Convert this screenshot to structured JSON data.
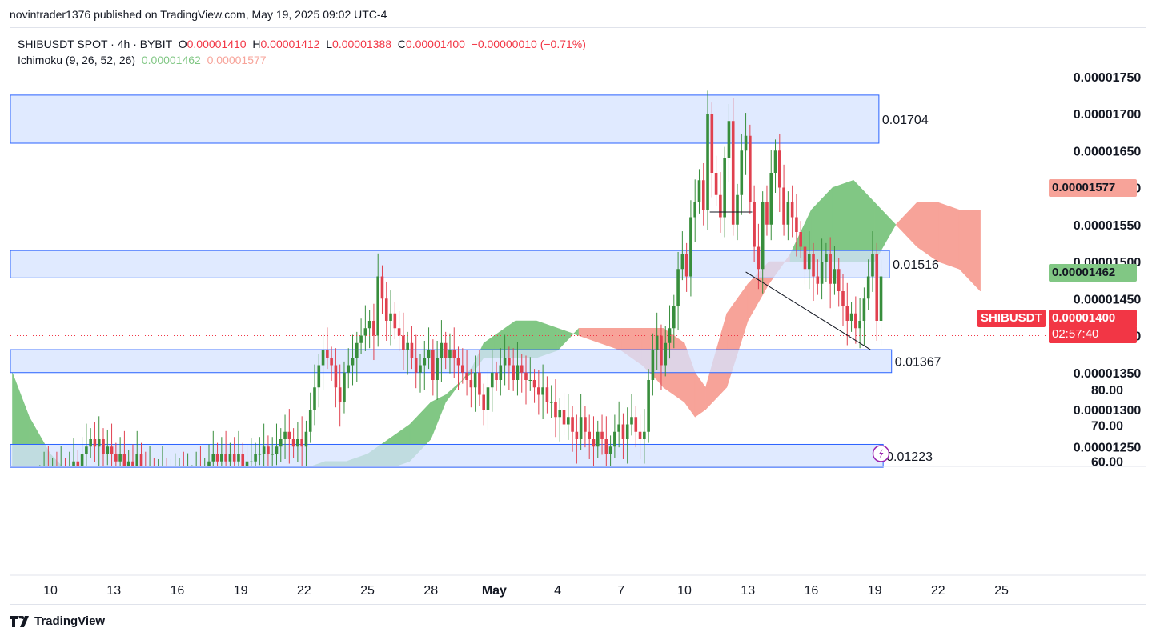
{
  "publish_line": "novintrader1376 published on TradingView.com, May 19, 2025 09:02 UTC-4",
  "legend": {
    "symbol_line": "SHIBUSDT SPOT · 4h · BYBIT",
    "o_label": "O",
    "o_value": "0.00001410",
    "h_label": "H",
    "h_value": "0.00001412",
    "l_label": "L",
    "l_value": "0.00001388",
    "c_label": "C",
    "c_value": "0.00001400",
    "change": "−0.00000010 (−0.71%)",
    "indicator": "Ichimoku (9, 26, 52, 26)",
    "ind_value_1": "0.00001462",
    "ind_value_2": "0.00001577"
  },
  "tags": {
    "senkou_b": "0.00001577",
    "senkou_a": "0.00001462",
    "symbol": "SHIBUSDT",
    "last_price": "0.00001400",
    "countdown": "02:57:40"
  },
  "brand": "TradingView",
  "colors": {
    "up": "#26a69a",
    "candle_up": "#388e3c",
    "candle_down": "#e0414f",
    "cloud_bull": "#81c784",
    "cloud_bear": "#f7a399",
    "zone_fill": "#d6e3ff",
    "zone_border": "#2962ff",
    "price_line": "#f23645"
  },
  "chart_data": {
    "type": "candlestick",
    "ylim": [
      1.22e-05,
      1.78e-05
    ],
    "price_axis_ticks": [
      "0.00001750",
      "0.00001700",
      "0.00001650",
      "0.00001600",
      "0.00001550",
      "0.00001500",
      "0.00001450",
      "0.00001400",
      "0.00001350",
      "0.00001300",
      "0.00001250"
    ],
    "price_axis_tick_values": [
      1.75e-05,
      1.7e-05,
      1.65e-05,
      1.6e-05,
      1.55e-05,
      1.5e-05,
      1.45e-05,
      1.4e-05,
      1.35e-05,
      1.3e-05,
      1.25e-05
    ],
    "lower_axis_ticks": [
      "80.00",
      "70.00",
      "60.00"
    ],
    "lower_axis_tick_values": [
      80,
      70,
      60
    ],
    "lower_axis_range": [
      50,
      84
    ],
    "x_axis_ticks": [
      {
        "label": "10",
        "day": 0
      },
      {
        "label": "13",
        "day": 3
      },
      {
        "label": "16",
        "day": 6
      },
      {
        "label": "19",
        "day": 9
      },
      {
        "label": "22",
        "day": 12
      },
      {
        "label": "25",
        "day": 15
      },
      {
        "label": "28",
        "day": 18
      },
      {
        "label": "May",
        "day": 21,
        "bold": true
      },
      {
        "label": "4",
        "day": 24
      },
      {
        "label": "7",
        "day": 27
      },
      {
        "label": "10",
        "day": 30
      },
      {
        "label": "13",
        "day": 33
      },
      {
        "label": "16",
        "day": 36
      },
      {
        "label": "19",
        "day": 39
      },
      {
        "label": "22",
        "day": 42
      },
      {
        "label": "25",
        "day": 45
      }
    ],
    "zones": [
      {
        "label": "0.01704",
        "top": 1.725e-05,
        "bottom": 1.66e-05,
        "end_day": 39.2
      },
      {
        "label": "0.01516",
        "top": 1.515e-05,
        "bottom": 1.478e-05,
        "end_day": 39.7
      },
      {
        "label": "0.01367",
        "top": 1.381e-05,
        "bottom": 1.35e-05,
        "end_day": 39.8
      },
      {
        "label": "0.01223",
        "top": 1.253e-05,
        "bottom": 1.222e-05,
        "end_day": 39.4
      }
    ],
    "trendlines": [
      {
        "from": [
          32.9,
          1.486e-05
        ],
        "to": [
          38.8,
          1.381e-05
        ]
      },
      {
        "from": [
          31.2,
          1.567e-05
        ],
        "to": [
          33.2,
          1.567e-05
        ]
      }
    ],
    "last_price": 1.4e-05,
    "cloud": {
      "days": [
        -1.8,
        -1,
        0,
        1,
        2,
        3,
        4,
        5,
        6,
        7,
        8,
        9,
        10,
        11,
        11.5,
        12,
        13,
        14,
        15,
        16,
        17,
        18,
        18.7,
        19.5,
        20,
        20.5,
        21,
        22,
        23,
        24,
        25,
        26,
        27,
        28,
        28.7,
        29,
        30,
        30.5,
        31,
        32,
        33,
        34,
        35,
        36,
        37,
        38,
        39,
        40,
        41,
        42,
        43,
        44
      ],
      "span_a": [
        1.35e-05,
        1.29e-05,
        1.24e-05,
        1.21e-05,
        1.21e-05,
        1.21e-05,
        1.21e-05,
        1.21e-05,
        1.21e-05,
        1.21e-05,
        1.21e-05,
        1.22e-05,
        1.22e-05,
        1.22e-05,
        1.22e-05,
        1.22e-05,
        1.23e-05,
        1.23e-05,
        1.24e-05,
        1.26e-05,
        1.28e-05,
        1.31e-05,
        1.32e-05,
        1.34e-05,
        1.36e-05,
        1.39e-05,
        1.4e-05,
        1.42e-05,
        1.42e-05,
        1.41e-05,
        1.4e-05,
        1.39e-05,
        1.38e-05,
        1.36e-05,
        1.34e-05,
        1.33e-05,
        1.31e-05,
        1.29e-05,
        1.3e-05,
        1.33e-05,
        1.42e-05,
        1.47e-05,
        1.51e-05,
        1.57e-05,
        1.6e-05,
        1.61e-05,
        1.58e-05,
        1.55e-05,
        1.52e-05,
        1.5e-05,
        1.49e-05,
        1.46e-05
      ],
      "span_b": [
        1.18e-05,
        1.18e-05,
        1.18e-05,
        1.18e-05,
        1.18e-05,
        1.18e-05,
        1.18e-05,
        1.18e-05,
        1.18e-05,
        1.18e-05,
        1.18e-05,
        1.18e-05,
        1.18e-05,
        1.19e-05,
        1.2e-05,
        1.2e-05,
        1.21e-05,
        1.22e-05,
        1.22e-05,
        1.22e-05,
        1.23e-05,
        1.26e-05,
        1.31e-05,
        1.34e-05,
        1.35e-05,
        1.37e-05,
        1.37e-05,
        1.37e-05,
        1.37e-05,
        1.38e-05,
        1.41e-05,
        1.41e-05,
        1.41e-05,
        1.41e-05,
        1.41e-05,
        1.41e-05,
        1.39e-05,
        1.35e-05,
        1.33e-05,
        1.43e-05,
        1.47e-05,
        1.5e-05,
        1.5e-05,
        1.5e-05,
        1.5e-05,
        1.5e-05,
        1.5e-05,
        1.55e-05,
        1.58e-05,
        1.58e-05,
        1.57e-05,
        1.57e-05
      ]
    },
    "candles_days": [
      -0.5,
      -0.3,
      -0.1,
      0.1,
      0.3,
      0.5,
      0.7,
      0.9,
      1.1,
      1.3,
      1.5,
      1.7,
      1.9,
      2.1,
      2.3,
      2.5,
      2.7,
      2.9,
      3.1,
      3.3,
      3.5,
      3.7,
      3.9,
      4.1,
      4.3,
      4.5,
      4.7,
      4.9,
      5.1,
      5.3,
      5.5,
      5.7,
      5.9,
      6.1,
      6.3,
      6.5,
      6.7,
      6.9,
      7.1,
      7.3,
      7.5,
      7.7,
      7.9,
      8.1,
      8.3,
      8.5,
      8.7,
      8.9,
      9.1,
      9.3,
      9.5,
      9.7,
      9.9,
      10.1,
      10.3,
      10.5,
      10.7,
      10.9,
      11.1,
      11.3,
      11.5,
      11.7,
      11.9,
      12.1,
      12.3,
      12.5,
      12.7,
      12.9,
      13.1,
      13.3,
      13.5,
      13.7,
      13.9,
      14.1,
      14.3,
      14.5,
      14.7,
      14.9,
      15.1,
      15.3,
      15.5,
      15.7,
      15.9,
      16.1,
      16.3,
      16.5,
      16.7,
      16.9,
      17.1,
      17.3,
      17.5,
      17.7,
      17.9,
      18.1,
      18.3,
      18.5,
      18.7,
      18.9,
      19.1,
      19.3,
      19.5,
      19.7,
      19.9,
      20.1,
      20.3,
      20.5,
      20.7,
      20.9,
      21.1,
      21.3,
      21.5,
      21.7,
      21.9,
      22.1,
      22.3,
      22.5,
      22.7,
      22.9,
      23.1,
      23.3,
      23.5,
      23.7,
      23.9,
      24.1,
      24.3,
      24.5,
      24.7,
      24.9,
      25.1,
      25.3,
      25.5,
      25.7,
      25.9,
      26.1,
      26.3,
      26.5,
      26.7,
      26.9,
      27.1,
      27.3,
      27.5,
      27.7,
      27.9,
      28.1,
      28.3,
      28.5,
      28.7,
      28.9,
      29.1,
      29.3,
      29.5,
      29.7,
      29.9,
      30.1,
      30.3,
      30.5,
      30.7,
      30.9,
      31.1,
      31.3,
      31.5,
      31.7,
      31.9,
      32.1,
      32.3,
      32.5,
      32.7,
      32.9,
      33.1,
      33.3,
      33.5,
      33.7,
      33.9,
      34.1,
      34.3,
      34.5,
      34.7,
      34.9,
      35.1,
      35.3,
      35.5,
      35.7,
      35.9,
      36.1,
      36.3,
      36.5,
      36.7,
      36.9,
      37.1,
      37.3,
      37.5,
      37.7,
      37.9,
      38.1,
      38.3,
      38.5,
      38.7,
      38.9,
      39.1,
      39.3
    ],
    "candles_close": [
      1.21e-05,
      1.22e-05,
      1.21e-05,
      1.22e-05,
      1.21e-05,
      1.22e-05,
      1.21e-05,
      1.22e-05,
      1.23e-05,
      1.22e-05,
      1.24e-05,
      1.25e-05,
      1.26e-05,
      1.25e-05,
      1.26e-05,
      1.24e-05,
      1.25e-05,
      1.24e-05,
      1.23e-05,
      1.24e-05,
      1.22e-05,
      1.23e-05,
      1.22e-05,
      1.24e-05,
      1.22e-05,
      1.21e-05,
      1.22e-05,
      1.21e-05,
      1.21e-05,
      1.22e-05,
      1.21e-05,
      1.21e-05,
      1.21e-05,
      1.22e-05,
      1.21e-05,
      1.21e-05,
      1.21e-05,
      1.22e-05,
      1.21e-05,
      1.22e-05,
      1.23e-05,
      1.24e-05,
      1.23e-05,
      1.24e-05,
      1.23e-05,
      1.24e-05,
      1.23e-05,
      1.24e-05,
      1.22e-05,
      1.23e-05,
      1.23e-05,
      1.24e-05,
      1.24e-05,
      1.25e-05,
      1.24e-05,
      1.24e-05,
      1.25e-05,
      1.26e-05,
      1.27e-05,
      1.26e-05,
      1.25e-05,
      1.26e-05,
      1.25e-05,
      1.27e-05,
      1.3e-05,
      1.33e-05,
      1.36e-05,
      1.38e-05,
      1.37e-05,
      1.36e-05,
      1.33e-05,
      1.31e-05,
      1.35e-05,
      1.36e-05,
      1.37e-05,
      1.39e-05,
      1.4e-05,
      1.41e-05,
      1.42e-05,
      1.4e-05,
      1.48e-05,
      1.45e-05,
      1.42e-05,
      1.43e-05,
      1.41e-05,
      1.4e-05,
      1.38e-05,
      1.39e-05,
      1.37e-05,
      1.35e-05,
      1.36e-05,
      1.37e-05,
      1.38e-05,
      1.34e-05,
      1.37e-05,
      1.39e-05,
      1.37e-05,
      1.38e-05,
      1.37e-05,
      1.36e-05,
      1.35e-05,
      1.34e-05,
      1.33e-05,
      1.35e-05,
      1.32e-05,
      1.3e-05,
      1.33e-05,
      1.35e-05,
      1.34e-05,
      1.36e-05,
      1.37e-05,
      1.36e-05,
      1.34e-05,
      1.36e-05,
      1.35e-05,
      1.34e-05,
      1.34e-05,
      1.33e-05,
      1.32e-05,
      1.33e-05,
      1.31e-05,
      1.31e-05,
      1.29e-05,
      1.3e-05,
      1.28e-05,
      1.29e-05,
      1.27e-05,
      1.26e-05,
      1.29e-05,
      1.27e-05,
      1.26e-05,
      1.25e-05,
      1.27e-05,
      1.26e-05,
      1.24e-05,
      1.25e-05,
      1.27e-05,
      1.28e-05,
      1.26e-05,
      1.28e-05,
      1.29e-05,
      1.27e-05,
      1.26e-05,
      1.27e-05,
      1.34e-05,
      1.38e-05,
      1.4e-05,
      1.36e-05,
      1.39e-05,
      1.41e-05,
      1.44e-05,
      1.49e-05,
      1.51e-05,
      1.48e-05,
      1.56e-05,
      1.58e-05,
      1.61e-05,
      1.57e-05,
      1.7e-05,
      1.62e-05,
      1.59e-05,
      1.56e-05,
      1.64e-05,
      1.69e-05,
      1.55e-05,
      1.59e-05,
      1.65e-05,
      1.67e-05,
      1.58e-05,
      1.52e-05,
      1.49e-05,
      1.58e-05,
      1.55e-05,
      1.62e-05,
      1.65e-05,
      1.6e-05,
      1.55e-05,
      1.58e-05,
      1.56e-05,
      1.54e-05,
      1.52e-05,
      1.49e-05,
      1.51e-05,
      1.48e-05,
      1.47e-05,
      1.5e-05,
      1.51e-05,
      1.47e-05,
      1.49e-05,
      1.46e-05,
      1.44e-05,
      1.42e-05,
      1.43e-05,
      1.41e-05,
      1.42e-05,
      1.45e-05,
      1.48e-05,
      1.51e-05,
      1.42e-05,
      1.48e-05,
      1.41e-05,
      1.41e-05,
      1.4e-05
    ],
    "last_day": 39.3
  }
}
